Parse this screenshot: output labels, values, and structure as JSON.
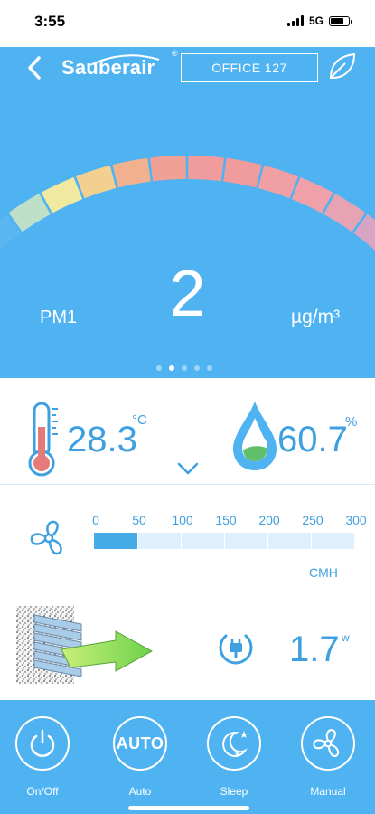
{
  "status_bar": {
    "time": "3:55",
    "network": "5G"
  },
  "header": {
    "brand": "Sauberair",
    "registered": "®",
    "location": "OFFICE 127"
  },
  "reading": {
    "label": "PM1",
    "value": "2",
    "unit": "µg/m³",
    "gauge_level": 0.02
  },
  "pager": {
    "pages": 5,
    "active": 1
  },
  "sensors": {
    "temperature": {
      "value": "28.3",
      "unit": "°C"
    },
    "humidity": {
      "value": "60.7",
      "unit": "%"
    }
  },
  "airflow": {
    "scale": [
      "0",
      "50",
      "100",
      "150",
      "200",
      "250",
      "300"
    ],
    "value": 50,
    "max": 300,
    "unit": "CMH"
  },
  "power": {
    "value": "1.7",
    "unit": "w"
  },
  "modes": [
    {
      "label": "On/Off",
      "icon": "power-icon"
    },
    {
      "label": "Auto",
      "icon": "auto-icon",
      "badge": "AUTO"
    },
    {
      "label": "Sleep",
      "icon": "moon-stars-icon"
    },
    {
      "label": "Manual",
      "icon": "fan-icon"
    }
  ],
  "colors": {
    "primary": "#4fb3f2",
    "text": "#3ea0e0",
    "thermometer": "#e47a7a",
    "droplet": "#4fb3f2",
    "droplet_fill": "#5fbf6a",
    "gauge_start": "#1c3fd6",
    "gauge_end": "#c8a3d8"
  }
}
